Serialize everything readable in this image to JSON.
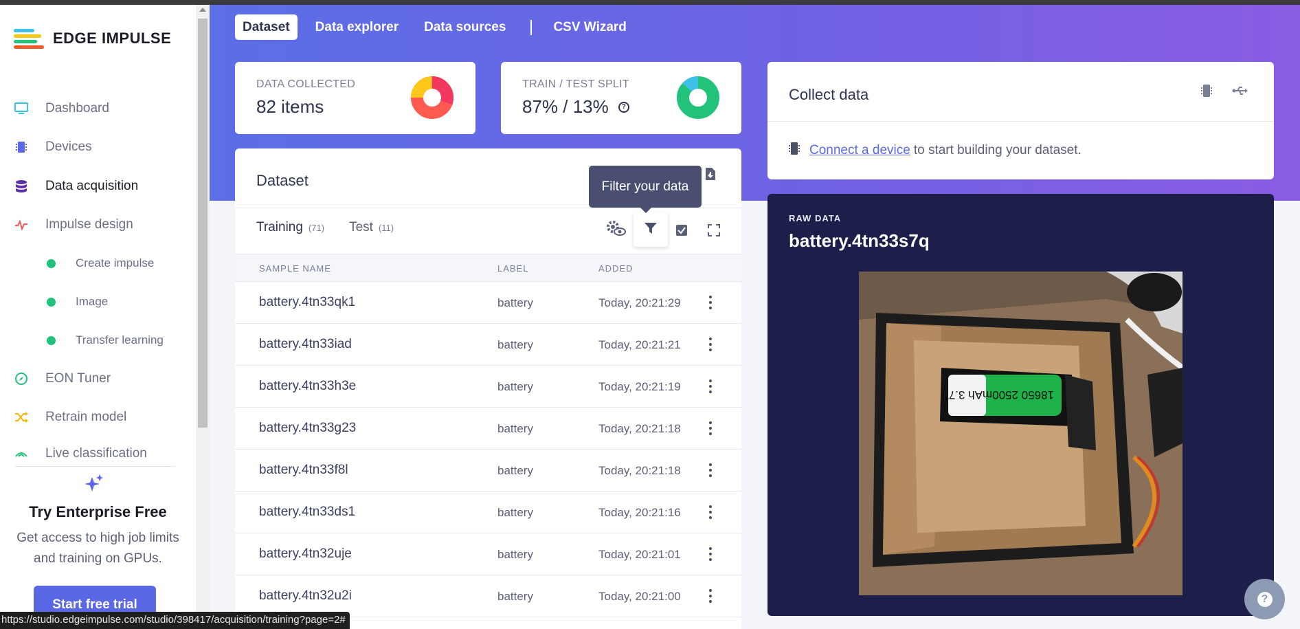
{
  "brand": {
    "name": "EDGE IMPULSE",
    "logo_colors": [
      "#21c27a",
      "#f5c518",
      "#3ec1e8",
      "#f05a28"
    ]
  },
  "sidebar": {
    "items": [
      {
        "label": "Dashboard",
        "icon": "monitor-icon",
        "active": false
      },
      {
        "label": "Devices",
        "icon": "chip-icon",
        "active": false
      },
      {
        "label": "Data acquisition",
        "icon": "database-icon",
        "active": true
      },
      {
        "label": "Impulse design",
        "icon": "pulse-icon",
        "active": false
      },
      {
        "label": "EON Tuner",
        "icon": "compass-icon",
        "active": false
      },
      {
        "label": "Retrain model",
        "icon": "shuffle-icon",
        "active": false
      },
      {
        "label": "Live classification",
        "icon": "signal-icon",
        "active": false
      }
    ],
    "subitems": [
      {
        "label": "Create impulse"
      },
      {
        "label": "Image"
      },
      {
        "label": "Transfer learning"
      }
    ]
  },
  "promo": {
    "title": "Try Enterprise Free",
    "text": "Get access to high job limits and training on GPUs.",
    "button": "Start free trial"
  },
  "top_tabs": [
    {
      "label": "Dataset",
      "active": true
    },
    {
      "label": "Data explorer",
      "active": false
    },
    {
      "label": "Data sources",
      "active": false
    },
    {
      "label": "CSV Wizard",
      "active": false
    }
  ],
  "stats": {
    "collected_label": "DATA COLLECTED",
    "collected_value": "82 items",
    "split_label": "TRAIN / TEST SPLIT",
    "split_value": "87% / 13%",
    "split_help": "?"
  },
  "dataset": {
    "title": "Dataset",
    "tooltip": "Filter your data",
    "tabs": [
      {
        "label": "Training",
        "count": "(71)"
      },
      {
        "label": "Test",
        "count": "(11)"
      }
    ],
    "columns": [
      "SAMPLE NAME",
      "LABEL",
      "ADDED"
    ],
    "rows": [
      {
        "name": "battery.4tn33qk1",
        "label": "battery",
        "added": "Today, 20:21:29"
      },
      {
        "name": "battery.4tn33iad",
        "label": "battery",
        "added": "Today, 20:21:21"
      },
      {
        "name": "battery.4tn33h3e",
        "label": "battery",
        "added": "Today, 20:21:19"
      },
      {
        "name": "battery.4tn33g23",
        "label": "battery",
        "added": "Today, 20:21:18"
      },
      {
        "name": "battery.4tn33f8l",
        "label": "battery",
        "added": "Today, 20:21:18"
      },
      {
        "name": "battery.4tn33ds1",
        "label": "battery",
        "added": "Today, 20:21:16"
      },
      {
        "name": "battery.4tn32uje",
        "label": "battery",
        "added": "Today, 20:21:01"
      },
      {
        "name": "battery.4tn32u2i",
        "label": "battery",
        "added": "Today, 20:21:00"
      }
    ]
  },
  "collect": {
    "title": "Collect data",
    "link": "Connect a device",
    "text": "to start building your dataset."
  },
  "raw": {
    "label": "RAW DATA",
    "name": "battery.4tn33s7q",
    "battery_text": "18650 2500mAh 3.7V"
  },
  "status_url": "https://studio.edgeimpulse.com/studio/398417/acquisition/training?page=2#",
  "help_fab": "?"
}
